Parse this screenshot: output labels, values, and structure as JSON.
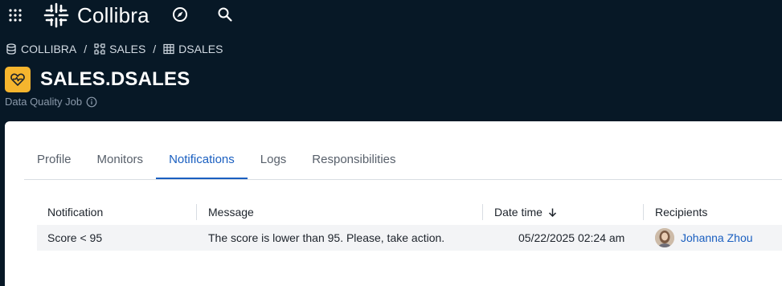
{
  "app": {
    "name": "Collibra"
  },
  "breadcrumb": [
    {
      "label": "COLLIBRA",
      "icon": "database-icon"
    },
    {
      "label": "SALES",
      "icon": "schema-icon"
    },
    {
      "label": "DSALES",
      "icon": "table-icon"
    }
  ],
  "breadcrumb_separator": "/",
  "asset": {
    "title": "SALES.DSALES",
    "type": "Data Quality Job",
    "icon": "heart-monitor-icon",
    "icon_color": "#f5b52e"
  },
  "tabs": [
    {
      "label": "Profile",
      "active": false
    },
    {
      "label": "Monitors",
      "active": false
    },
    {
      "label": "Notifications",
      "active": true
    },
    {
      "label": "Logs",
      "active": false
    },
    {
      "label": "Responsibilities",
      "active": false
    }
  ],
  "table": {
    "columns": [
      "Notification",
      "Message",
      "Date time",
      "Recipients"
    ],
    "sort": {
      "column": "Date time",
      "direction": "descending",
      "icon": "arrow-down-icon"
    },
    "rows": [
      {
        "notification": "Score < 95",
        "message": "The score is lower than 95. Please, take action.",
        "date_time": "05/22/2025 02:24 am",
        "recipient": "Johanna Zhou"
      }
    ]
  },
  "colors": {
    "header_bg": "#071826",
    "accent": "#1a5fc0",
    "brand_yellow": "#f5b52e"
  }
}
